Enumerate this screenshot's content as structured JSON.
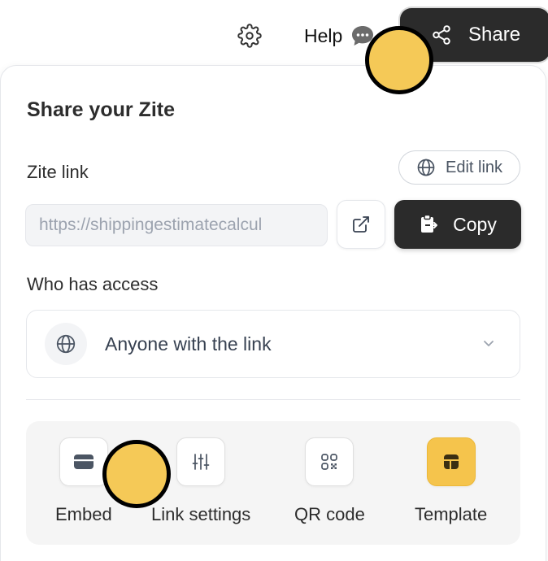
{
  "topbar": {
    "settings_icon": "gear-icon",
    "help_label": "Help",
    "help_icon": "chat-bubble-icon",
    "share_label": "Share",
    "share_icon": "share-nodes-icon"
  },
  "panel": {
    "title": "Share your Zite",
    "link_section": {
      "label": "Zite link",
      "edit_link_label": "Edit link",
      "url": "https://shippingestimatecalcul",
      "copy_label": "Copy"
    },
    "access_section": {
      "label": "Who has access",
      "selected": "Anyone with the link"
    },
    "actions": [
      {
        "label": "Embed",
        "icon": "embed-icon",
        "highlighted": false
      },
      {
        "label": "Link settings",
        "icon": "sliders-icon",
        "highlighted": false
      },
      {
        "label": "QR code",
        "icon": "qr-code-icon",
        "highlighted": false
      },
      {
        "label": "Template",
        "icon": "template-icon",
        "highlighted": true
      }
    ]
  },
  "colors": {
    "dark_button": "#2b2b2b",
    "template_tile": "#f5c44c",
    "marker": "#f5c957"
  }
}
